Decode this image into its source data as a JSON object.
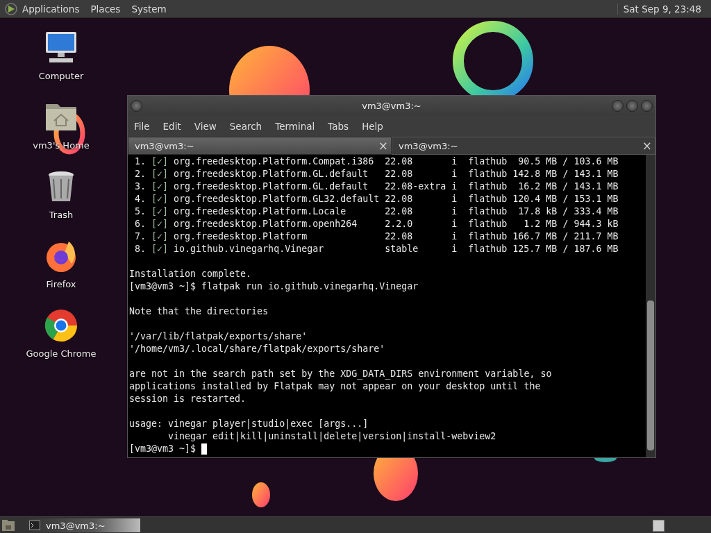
{
  "top_panel": {
    "menus": [
      "Applications",
      "Places",
      "System"
    ],
    "clock": "Sat Sep  9, 23:48"
  },
  "desktop_icons": [
    {
      "kind": "computer",
      "label": "Computer"
    },
    {
      "kind": "home",
      "label": "vm3's Home"
    },
    {
      "kind": "trash",
      "label": "Trash"
    },
    {
      "kind": "firefox",
      "label": "Firefox"
    },
    {
      "kind": "chrome",
      "label": "Google Chrome"
    }
  ],
  "window": {
    "title": "vm3@vm3:~",
    "menu": [
      "File",
      "Edit",
      "View",
      "Search",
      "Terminal",
      "Tabs",
      "Help"
    ],
    "tabs": [
      {
        "label": "vm3@vm3:~",
        "close": "×",
        "selected": false
      },
      {
        "label": "vm3@vm3:~",
        "close": "×",
        "selected": true
      }
    ],
    "install_rows": [
      {
        "index": "1.",
        "mark": "[✓]",
        "ref": "org.freedesktop.Platform.Compat.i386",
        "branch": "22.08",
        "op": "i",
        "remote": "flathub",
        "size": "90.5 MB / 103.6 MB"
      },
      {
        "index": "2.",
        "mark": "[✓]",
        "ref": "org.freedesktop.Platform.GL.default",
        "branch": "22.08",
        "op": "i",
        "remote": "flathub",
        "size": "142.8 MB / 143.1 MB"
      },
      {
        "index": "3.",
        "mark": "[✓]",
        "ref": "org.freedesktop.Platform.GL.default",
        "branch": "22.08-extra",
        "op": "i",
        "remote": "flathub",
        "size": "16.2 MB / 143.1 MB"
      },
      {
        "index": "4.",
        "mark": "[✓]",
        "ref": "org.freedesktop.Platform.GL32.default",
        "branch": "22.08",
        "op": "i",
        "remote": "flathub",
        "size": "120.4 MB / 153.1 MB"
      },
      {
        "index": "5.",
        "mark": "[✓]",
        "ref": "org.freedesktop.Platform.Locale",
        "branch": "22.08",
        "op": "i",
        "remote": "flathub",
        "size": "17.8 kB / 333.4 MB"
      },
      {
        "index": "6.",
        "mark": "[✓]",
        "ref": "org.freedesktop.Platform.openh264",
        "branch": "2.2.0",
        "op": "i",
        "remote": "flathub",
        "size": "1.2 MB / 944.3 kB"
      },
      {
        "index": "7.",
        "mark": "[✓]",
        "ref": "org.freedesktop.Platform",
        "branch": "22.08",
        "op": "i",
        "remote": "flathub",
        "size": "166.7 MB / 211.7 MB"
      },
      {
        "index": "8.",
        "mark": "[✓]",
        "ref": "io.github.vinegarhq.Vinegar",
        "branch": "stable",
        "op": "i",
        "remote": "flathub",
        "size": "125.7 MB / 187.6 MB"
      }
    ],
    "output_blocks": [
      [
        "Installation complete.",
        "[vm3@vm3 ~]$ flatpak run io.github.vinegarhq.Vinegar"
      ],
      [
        "Note that the directories"
      ],
      [
        "'/var/lib/flatpak/exports/share'",
        "'/home/vm3/.local/share/flatpak/exports/share'"
      ],
      [
        "are not in the search path set by the XDG_DATA_DIRS environment variable, so",
        "applications installed by Flatpak may not appear on your desktop until the",
        "session is restarted."
      ],
      [
        "usage: vinegar player|studio|exec [args...]",
        "       vinegar edit|kill|uninstall|delete|version|install-webview2"
      ]
    ],
    "prompt": "[vm3@vm3 ~]$"
  },
  "taskbar": {
    "tasks": [
      {
        "label": "vm3@vm3:~",
        "selected": true
      }
    ]
  }
}
